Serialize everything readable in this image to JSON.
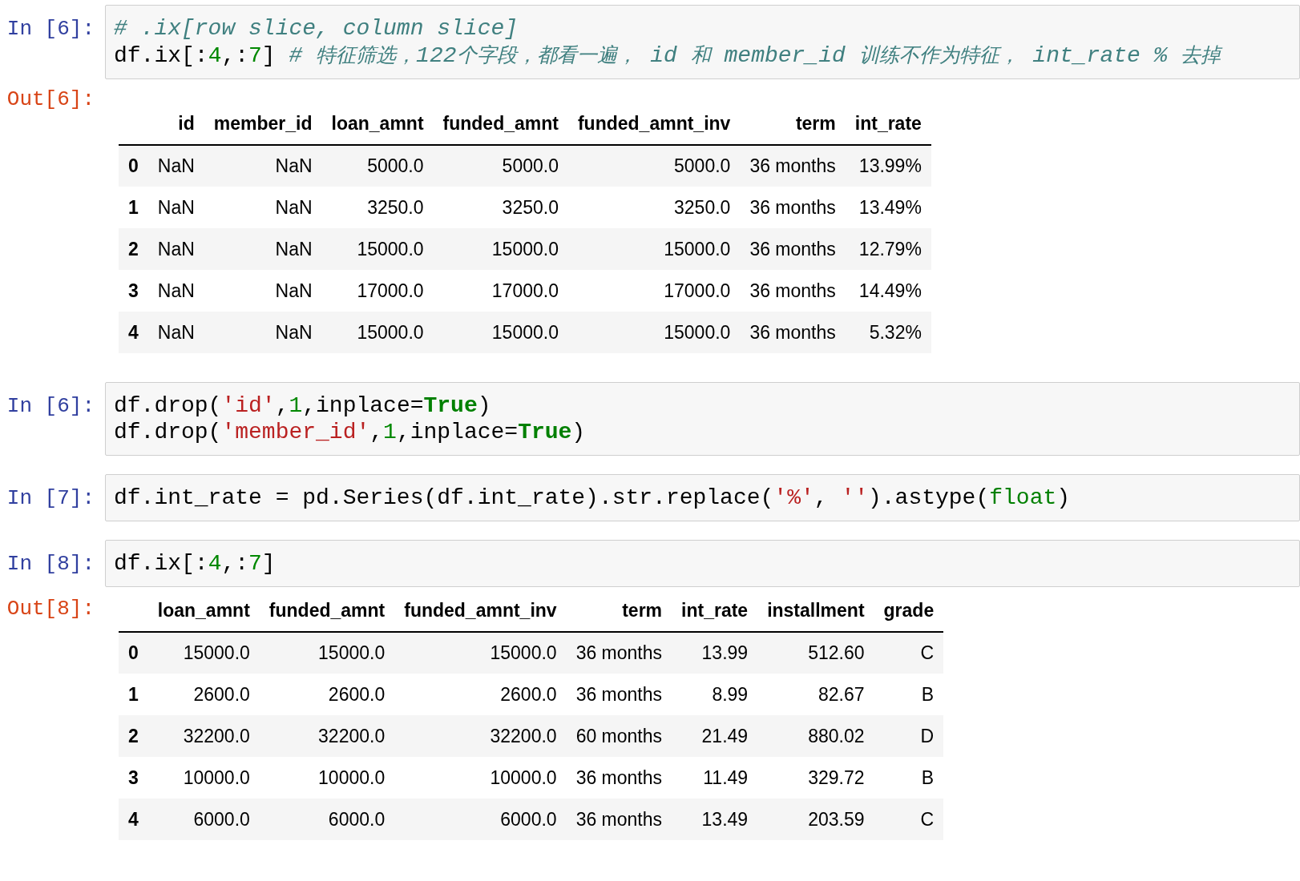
{
  "cells": [
    {
      "kind": "code",
      "prompt": "In [6]:",
      "lines": [
        [
          {
            "text": "# .ix[row slice, column slice]",
            "kind": "comment"
          }
        ],
        [
          {
            "text": "df.ix[:",
            "kind": "plain"
          },
          {
            "text": "4",
            "kind": "number"
          },
          {
            "text": ",:",
            "kind": "plain"
          },
          {
            "text": "7",
            "kind": "number"
          },
          {
            "text": "] ",
            "kind": "plain"
          },
          {
            "text": "# 特征筛选，122个字段，都看一遍， id 和 member_id 训练不作为特征， int_rate % 去掉",
            "kind": "comment"
          }
        ]
      ]
    },
    {
      "kind": "output",
      "prompt": "Out[6]:",
      "table": {
        "columns": [
          "id",
          "member_id",
          "loan_amnt",
          "funded_amnt",
          "funded_amnt_inv",
          "term",
          "int_rate"
        ],
        "rows": [
          {
            "index": "0",
            "cells": [
              "NaN",
              "NaN",
              "5000.0",
              "5000.0",
              "5000.0",
              "36 months",
              "13.99%"
            ]
          },
          {
            "index": "1",
            "cells": [
              "NaN",
              "NaN",
              "3250.0",
              "3250.0",
              "3250.0",
              "36 months",
              "13.49%"
            ]
          },
          {
            "index": "2",
            "cells": [
              "NaN",
              "NaN",
              "15000.0",
              "15000.0",
              "15000.0",
              "36 months",
              "12.79%"
            ]
          },
          {
            "index": "3",
            "cells": [
              "NaN",
              "NaN",
              "17000.0",
              "17000.0",
              "17000.0",
              "36 months",
              "14.49%"
            ]
          },
          {
            "index": "4",
            "cells": [
              "NaN",
              "NaN",
              "15000.0",
              "15000.0",
              "15000.0",
              "36 months",
              "5.32%"
            ]
          }
        ]
      }
    },
    {
      "kind": "code",
      "prompt": "In [6]:",
      "lines": [
        [
          {
            "text": "df.drop(",
            "kind": "plain"
          },
          {
            "text": "'id'",
            "kind": "string"
          },
          {
            "text": ",",
            "kind": "plain"
          },
          {
            "text": "1",
            "kind": "number"
          },
          {
            "text": ",inplace=",
            "kind": "plain"
          },
          {
            "text": "True",
            "kind": "keyword"
          },
          {
            "text": ")",
            "kind": "plain"
          }
        ],
        [
          {
            "text": "df.drop(",
            "kind": "plain"
          },
          {
            "text": "'member_id'",
            "kind": "string"
          },
          {
            "text": ",",
            "kind": "plain"
          },
          {
            "text": "1",
            "kind": "number"
          },
          {
            "text": ",inplace=",
            "kind": "plain"
          },
          {
            "text": "True",
            "kind": "keyword"
          },
          {
            "text": ")",
            "kind": "plain"
          }
        ]
      ]
    },
    {
      "kind": "code",
      "prompt": "In [7]:",
      "lines": [
        [
          {
            "text": "df.int_rate = pd.Series(df.int_rate).str.replace(",
            "kind": "plain"
          },
          {
            "text": "'%'",
            "kind": "string"
          },
          {
            "text": ", ",
            "kind": "plain"
          },
          {
            "text": "''",
            "kind": "string"
          },
          {
            "text": ").astype(",
            "kind": "plain"
          },
          {
            "text": "float",
            "kind": "builtin"
          },
          {
            "text": ")",
            "kind": "plain"
          }
        ]
      ]
    },
    {
      "kind": "code",
      "prompt": "In [8]:",
      "lines": [
        [
          {
            "text": "df.ix[:",
            "kind": "plain"
          },
          {
            "text": "4",
            "kind": "number"
          },
          {
            "text": ",:",
            "kind": "plain"
          },
          {
            "text": "7",
            "kind": "number"
          },
          {
            "text": "]",
            "kind": "plain"
          }
        ]
      ]
    },
    {
      "kind": "output",
      "prompt": "Out[8]:",
      "table": {
        "columns": [
          "loan_amnt",
          "funded_amnt",
          "funded_amnt_inv",
          "term",
          "int_rate",
          "installment",
          "grade"
        ],
        "rows": [
          {
            "index": "0",
            "cells": [
              "15000.0",
              "15000.0",
              "15000.0",
              "36 months",
              "13.99",
              "512.60",
              "C"
            ]
          },
          {
            "index": "1",
            "cells": [
              "2600.0",
              "2600.0",
              "2600.0",
              "36 months",
              "8.99",
              "82.67",
              "B"
            ]
          },
          {
            "index": "2",
            "cells": [
              "32200.0",
              "32200.0",
              "32200.0",
              "60 months",
              "21.49",
              "880.02",
              "D"
            ]
          },
          {
            "index": "3",
            "cells": [
              "10000.0",
              "10000.0",
              "10000.0",
              "36 months",
              "11.49",
              "329.72",
              "B"
            ]
          },
          {
            "index": "4",
            "cells": [
              "6000.0",
              "6000.0",
              "6000.0",
              "36 months",
              "13.49",
              "203.59",
              "C"
            ]
          }
        ]
      }
    }
  ]
}
